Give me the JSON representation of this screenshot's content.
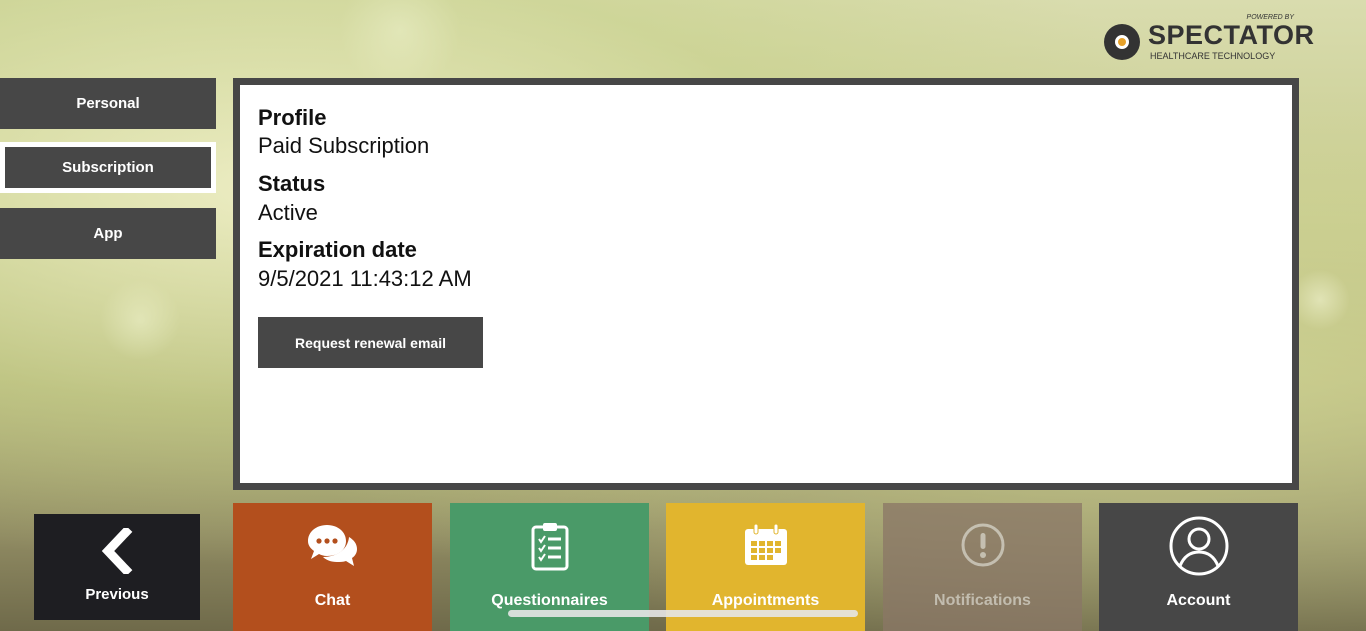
{
  "logo": {
    "powered_by": "POWERED BY",
    "brand": "SPECTATOR",
    "tagline": "HEALTHCARE TECHNOLOGY"
  },
  "sidebar": {
    "items": [
      {
        "label": "Personal",
        "active": false
      },
      {
        "label": "Subscription",
        "active": true
      },
      {
        "label": "App",
        "active": false
      }
    ]
  },
  "subscription": {
    "profile_label": "Profile",
    "profile_value": "Paid Subscription",
    "status_label": "Status",
    "status_value": "Active",
    "expiration_label": "Expiration date",
    "expiration_value": "9/5/2021 11:43:12 AM",
    "renew_button": "Request renewal email"
  },
  "bottom_nav": {
    "previous": {
      "label": "Previous",
      "icon": "chevron-left-icon"
    },
    "tiles": [
      {
        "label": "Chat",
        "icon": "chat-bubbles-icon",
        "color": "#b34f1d"
      },
      {
        "label": "Questionnaires",
        "icon": "clipboard-checklist-icon",
        "color": "#4a9a68"
      },
      {
        "label": "Appointments",
        "icon": "calendar-icon",
        "color": "#e1b52e"
      },
      {
        "label": "Notifications",
        "icon": "alert-circle-icon",
        "color": "#8a7766",
        "disabled": true
      },
      {
        "label": "Account",
        "icon": "user-circle-icon",
        "color": "#474747"
      }
    ]
  },
  "colors": {
    "panel_dark": "#474747",
    "previous_bg": "#1e1e22"
  }
}
